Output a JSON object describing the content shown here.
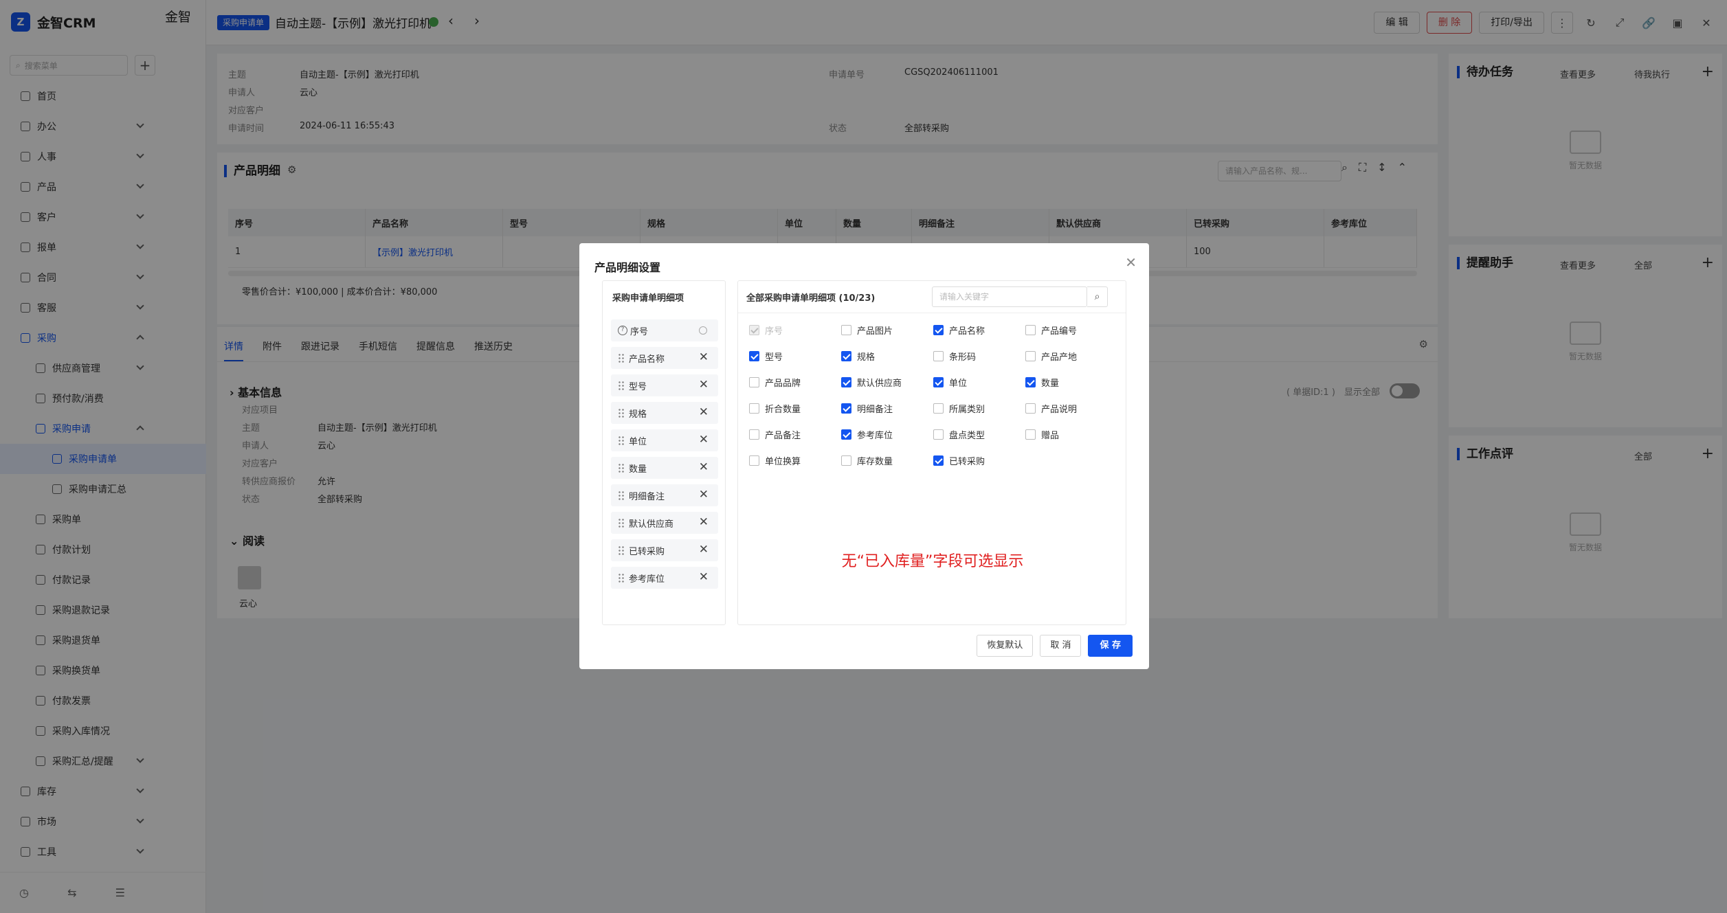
{
  "sidebar": {
    "logo_text": "金智CRM",
    "search_placeholder": "搜索菜单",
    "add_label": "+",
    "items": [
      {
        "label": "首页"
      },
      {
        "label": "办公"
      },
      {
        "label": "人事"
      },
      {
        "label": "产品"
      },
      {
        "label": "客户"
      },
      {
        "label": "报单"
      },
      {
        "label": "合同"
      },
      {
        "label": "客服"
      },
      {
        "label": "采购"
      },
      {
        "label": "供应商管理"
      },
      {
        "label": "预付款/消费"
      },
      {
        "label": "采购申请"
      },
      {
        "label": "采购申请单"
      },
      {
        "label": "采购申请汇总"
      },
      {
        "label": "采购单"
      },
      {
        "label": "付款计划"
      },
      {
        "label": "付款记录"
      },
      {
        "label": "采购退款记录"
      },
      {
        "label": "采购退货单"
      },
      {
        "label": "采购换货单"
      },
      {
        "label": "付款发票"
      },
      {
        "label": "采购入库情况"
      },
      {
        "label": "采购汇总/提醒"
      },
      {
        "label": "库存"
      },
      {
        "label": "市场"
      },
      {
        "label": "工具"
      }
    ]
  },
  "background": {
    "app_title": "金智",
    "tab": "采购申"
  },
  "drawer": {
    "tag": "采购申请单",
    "title": "自动主题-【示例】激光打印机",
    "actions": {
      "edit": "编 辑",
      "delete": "删 除",
      "print": "打印/导出"
    },
    "info": {
      "subject_label": "主题",
      "subject": "自动主题-【示例】激光打印机",
      "applicant_label": "申请人",
      "applicant": "云心",
      "customer_label": "对应客户",
      "time_label": "申请时间",
      "time": "2024-06-11 16:55:43",
      "no_label": "申请单号",
      "no": "CGSQ202406111001",
      "status_label": "状态",
      "status": "全部转采购"
    },
    "product_detail": {
      "title": "产品明细",
      "search_placeholder": "请输入产品名称、规...",
      "columns": [
        "序号",
        "产品名称",
        "型号",
        "规格",
        "单位",
        "数量",
        "明细备注",
        "默认供应商",
        "已转采购",
        "参考库位"
      ],
      "rows": [
        [
          "1",
          "【示例】激光打印机",
          "",
          "",
          "",
          "",
          "",
          "",
          "100",
          ""
        ]
      ],
      "footer": "零售价合计：¥100,000 |    成本价合计：¥80,000"
    },
    "tabs": [
      "详情",
      "附件",
      "跟进记录",
      "手机短信",
      "提醒信息",
      "推送历史"
    ],
    "basic_info": {
      "title": "基本信息",
      "meta": "( 单据ID:1 )",
      "show_all": "显示全部",
      "fields": [
        {
          "label": "对应项目",
          "value": ""
        },
        {
          "label": "主题",
          "value": "自动主题-【示例】激光打印机"
        },
        {
          "label": "申请人",
          "value": "云心"
        },
        {
          "label": "对应客户",
          "value": ""
        },
        {
          "label": "转供应商报价",
          "value": "允许"
        },
        {
          "label": "状态",
          "value": "全部转采购"
        }
      ],
      "read_title": "阅读",
      "reader": "云心"
    },
    "right_panels": [
      {
        "title": "待办任务",
        "more": "查看更多",
        "filter": "待我执行",
        "empty": "暂无数据"
      },
      {
        "title": "提醒助手",
        "more": "查看更多",
        "filter": "全部",
        "empty": "暂无数据"
      },
      {
        "title": "工作点评",
        "more": "",
        "filter": "全部",
        "empty": "暂无数据"
      }
    ]
  },
  "modal": {
    "title": "产品明细设置",
    "left_title": "采购申请单明细项",
    "selected": [
      "序号",
      "产品名称",
      "型号",
      "规格",
      "单位",
      "数量",
      "明细备注",
      "默认供应商",
      "已转采购",
      "参考库位"
    ],
    "right_title": "全部采购申请单明细项 (10/23)",
    "search_placeholder": "请输入关键字",
    "options": [
      {
        "label": "序号",
        "checked": true,
        "disabled": true
      },
      {
        "label": "产品图片",
        "checked": false
      },
      {
        "label": "产品名称",
        "checked": true
      },
      {
        "label": "产品编号",
        "checked": false
      },
      {
        "label": "型号",
        "checked": true
      },
      {
        "label": "规格",
        "checked": true
      },
      {
        "label": "条形码",
        "checked": false
      },
      {
        "label": "产品产地",
        "checked": false
      },
      {
        "label": "产品品牌",
        "checked": false
      },
      {
        "label": "默认供应商",
        "checked": true
      },
      {
        "label": "单位",
        "checked": true
      },
      {
        "label": "数量",
        "checked": true
      },
      {
        "label": "折合数量",
        "checked": false
      },
      {
        "label": "明细备注",
        "checked": true
      },
      {
        "label": "所属类别",
        "checked": false
      },
      {
        "label": "产品说明",
        "checked": false
      },
      {
        "label": "产品备注",
        "checked": false
      },
      {
        "label": "参考库位",
        "checked": true
      },
      {
        "label": "盘点类型",
        "checked": false
      },
      {
        "label": "赠品",
        "checked": false
      },
      {
        "label": "单位换算",
        "checked": false
      },
      {
        "label": "库存数量",
        "checked": false
      },
      {
        "label": "已转采购",
        "checked": true
      }
    ],
    "annotation": "无“已入库量”字段可选显示",
    "buttons": {
      "reset": "恢复默认",
      "cancel": "取 消",
      "save": "保 存"
    }
  }
}
